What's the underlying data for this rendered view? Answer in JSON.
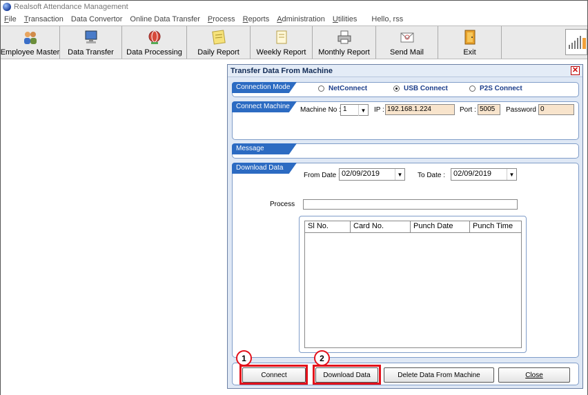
{
  "window": {
    "title": "Realsoft Attendance Management"
  },
  "menu": [
    {
      "label": "File",
      "u": "F",
      "rest": "ile"
    },
    {
      "label": "Transaction",
      "u": "T",
      "rest": "ransaction"
    },
    {
      "label": "Data Convertor",
      "u": "",
      "rest": "Data Convertor"
    },
    {
      "label": "Online Data Transfer",
      "u": "",
      "rest": "Online Data Transfer"
    },
    {
      "label": "Process",
      "u": "P",
      "rest": "rocess"
    },
    {
      "label": "Reports",
      "u": "R",
      "rest": "eports"
    },
    {
      "label": "Administration",
      "u": "A",
      "rest": "dministration"
    },
    {
      "label": "Utilities",
      "u": "U",
      "rest": "tilities"
    },
    {
      "label": "Hello, rss",
      "u": "",
      "rest": "Hello, rss"
    }
  ],
  "toolbar": [
    {
      "label": "Employee Master",
      "icon": "employees-icon"
    },
    {
      "label": "Data Transfer",
      "icon": "computer-icon"
    },
    {
      "label": "Data Processing",
      "icon": "globe-icon"
    },
    {
      "label": "Daily Report",
      "icon": "note-icon"
    },
    {
      "label": "Weekly Report",
      "icon": "document-icon"
    },
    {
      "label": "Monthly Report",
      "icon": "printer-icon"
    },
    {
      "label": "Send Mail",
      "icon": "envelope-icon"
    },
    {
      "label": "Exit",
      "icon": "exit-door-icon"
    }
  ],
  "dialog": {
    "title": "Transfer Data From Machine",
    "connection_mode": {
      "tag": "Connection Mode",
      "options": [
        "NetConnect",
        "USB Connect",
        "P2S Connect"
      ],
      "selected": "USB Connect"
    },
    "connect_machine": {
      "tag": "Connect Machine",
      "machine_no_label": "Machine No :",
      "machine_no": "1",
      "ip_label": "IP :",
      "ip": "192.168.1.224",
      "port_label": "Port :",
      "port": "5005",
      "password_label": "Password",
      "password": "0"
    },
    "message": {
      "tag": "Message"
    },
    "download": {
      "tag": "Download Data",
      "from_label": "From Date :",
      "from_date": "02/09/2019",
      "to_label": "To Date :",
      "to_date": "02/09/2019",
      "process_label": "Process",
      "columns": [
        "Sl No.",
        "Card No.",
        "Punch Date",
        "Punch Time"
      ]
    },
    "buttons": {
      "connect": "Connect",
      "download": "Download Data",
      "delete": "Delete Data From Machine",
      "close": "Close"
    },
    "callouts": [
      "1",
      "2"
    ],
    "colors": {
      "accent": "#2c6bc2",
      "highlight": "#e3101a",
      "field_tan": "#f8e4cc"
    }
  }
}
